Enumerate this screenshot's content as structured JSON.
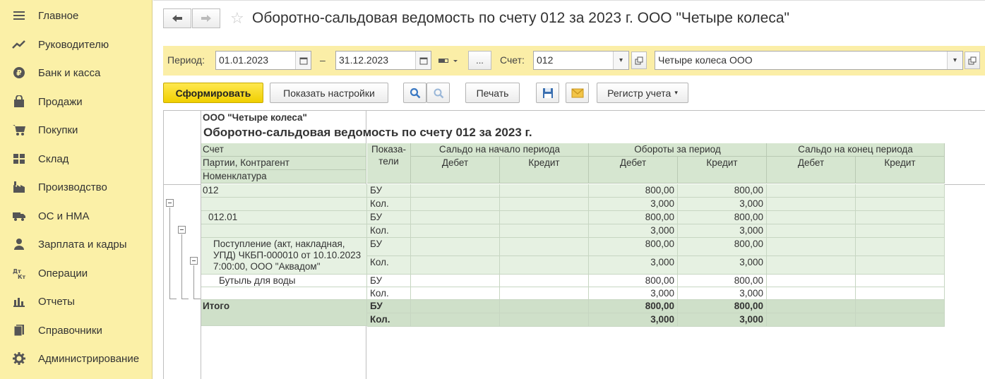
{
  "sidebar": {
    "items": [
      {
        "label": "Главное",
        "icon": "menu-icon"
      },
      {
        "label": "Руководителю",
        "icon": "trend-icon"
      },
      {
        "label": "Банк и касса",
        "icon": "ruble-coin-icon"
      },
      {
        "label": "Продажи",
        "icon": "shopping-bag-icon"
      },
      {
        "label": "Покупки",
        "icon": "cart-icon"
      },
      {
        "label": "Склад",
        "icon": "warehouse-icon"
      },
      {
        "label": "Производство",
        "icon": "factory-icon"
      },
      {
        "label": "ОС и НМА",
        "icon": "truck-icon"
      },
      {
        "label": "Зарплата и кадры",
        "icon": "person-icon"
      },
      {
        "label": "Операции",
        "icon": "dt-kt-icon"
      },
      {
        "label": "Отчеты",
        "icon": "bar-chart-icon"
      },
      {
        "label": "Справочники",
        "icon": "books-icon"
      },
      {
        "label": "Администрирование",
        "icon": "gear-icon"
      }
    ]
  },
  "header": {
    "title": "Оборотно-сальдовая ведомость по счету 012 за 2023 г. ООО \"Четыре колеса\""
  },
  "filters": {
    "period_label": "Период:",
    "date_from": "01.01.2023",
    "dash": "–",
    "date_to": "31.12.2023",
    "ellipsis": "...",
    "account_label": "Счет:",
    "account_value": "012",
    "org_value": "Четыре колеса ООО"
  },
  "toolbar": {
    "generate": "Сформировать",
    "show_settings": "Показать настройки",
    "print": "Печать",
    "register": "Регистр учета"
  },
  "report": {
    "org": "ООО \"Четыре колеса\"",
    "title": "Оборотно-сальдовая ведомость по счету 012 за 2023 г.",
    "hdr_left": [
      "Счет",
      "Партии, Контрагент",
      "Номенклатура"
    ],
    "hdr_indicators": "Показа-\nтели",
    "groups": [
      "Сальдо на начало периода",
      "Обороты за период",
      "Сальдо на конец периода"
    ],
    "subcols": [
      "Дебет",
      "Кредит",
      "Дебет",
      "Кредит",
      "Дебет",
      "Кредит"
    ],
    "rows": [
      {
        "name": "012",
        "ind": "БУ",
        "turn_d": "800,00",
        "turn_c": "800,00"
      },
      {
        "name": "",
        "ind": "Кол.",
        "turn_d": "3,000",
        "turn_c": "3,000"
      },
      {
        "name": "012.01",
        "ind": "БУ",
        "turn_d": "800,00",
        "turn_c": "800,00"
      },
      {
        "name": "",
        "ind": "Кол.",
        "turn_d": "3,000",
        "turn_c": "3,000"
      },
      {
        "name": "Поступление (акт, накладная,\nУПД) ЧКБП-000010 от 10.10.2023\n7:00:00, ООО \"Аквадом\"",
        "ind": "БУ",
        "turn_d": "800,00",
        "turn_c": "800,00"
      },
      {
        "name": "",
        "ind": "Кол.",
        "turn_d": "3,000",
        "turn_c": "3,000"
      },
      {
        "name": "Бутыль для воды",
        "ind": "БУ",
        "turn_d": "800,00",
        "turn_c": "800,00"
      },
      {
        "name": "",
        "ind": "Кол.",
        "turn_d": "3,000",
        "turn_c": "3,000"
      }
    ],
    "total": {
      "name": "Итого",
      "ind1": "БУ",
      "ind2": "Кол.",
      "d1": "800,00",
      "c1": "800,00",
      "d2": "3,000",
      "c2": "3,000"
    }
  }
}
